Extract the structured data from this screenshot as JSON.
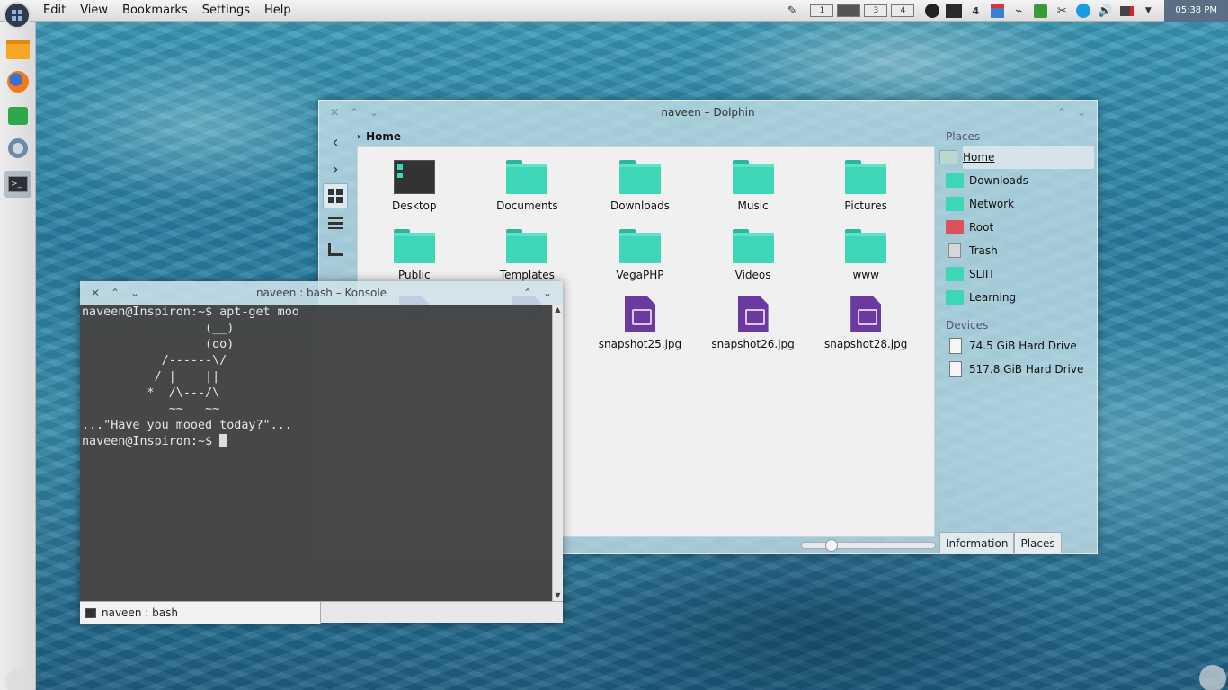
{
  "menubar": {
    "items": [
      "Edit",
      "View",
      "Bookmarks",
      "Settings",
      "Help"
    ]
  },
  "tray": {
    "pager": [
      "1",
      "",
      "3",
      "4"
    ],
    "badge": "4",
    "clock": "05:38 PM"
  },
  "dolphin": {
    "title": "naveen – Dolphin",
    "breadcrumb": "Home",
    "files": [
      {
        "label": "Desktop",
        "kind": "desktop"
      },
      {
        "label": "Documents",
        "kind": "folder"
      },
      {
        "label": "Downloads",
        "kind": "folder"
      },
      {
        "label": "Music",
        "kind": "folder"
      },
      {
        "label": "Pictures",
        "kind": "folder"
      },
      {
        "label": "Public",
        "kind": "folder"
      },
      {
        "label": "Templates",
        "kind": "folder"
      },
      {
        "label": "VegaPHP",
        "kind": "folder"
      },
      {
        "label": "Videos",
        "kind": "folder"
      },
      {
        "label": "www",
        "kind": "folder"
      },
      {
        "label": "",
        "kind": "image"
      },
      {
        "label": "g",
        "kind": "image"
      },
      {
        "label": "snapshot25.jpg",
        "kind": "image"
      },
      {
        "label": "snapshot26.jpg",
        "kind": "image"
      },
      {
        "label": "snapshot28.jpg",
        "kind": "image"
      }
    ],
    "places_heading": "Places",
    "places": [
      {
        "label": "Home",
        "icon": "home"
      },
      {
        "label": "Downloads",
        "icon": "folder"
      },
      {
        "label": "Network",
        "icon": "folder"
      },
      {
        "label": "Root",
        "icon": "folder-red"
      },
      {
        "label": "Trash",
        "icon": "trash"
      },
      {
        "label": "SLIIT",
        "icon": "folder"
      },
      {
        "label": "Learning",
        "icon": "folder"
      }
    ],
    "devices_heading": "Devices",
    "devices": [
      "74.5 GiB Hard Drive",
      "517.8 GiB Hard Drive"
    ],
    "tabs": [
      "Information",
      "Places"
    ]
  },
  "konsole": {
    "title": "naveen : bash – Konsole",
    "lines": [
      "naveen@Inspiron:~$ apt-get moo",
      "                 (__)",
      "                 (oo)",
      "           /------\\/",
      "          / |    ||",
      "         *  /\\---/\\",
      "            ~~   ~~",
      "...\"Have you mooed today?\"...",
      "naveen@Inspiron:~$ "
    ],
    "tab_label": "naveen : bash"
  }
}
